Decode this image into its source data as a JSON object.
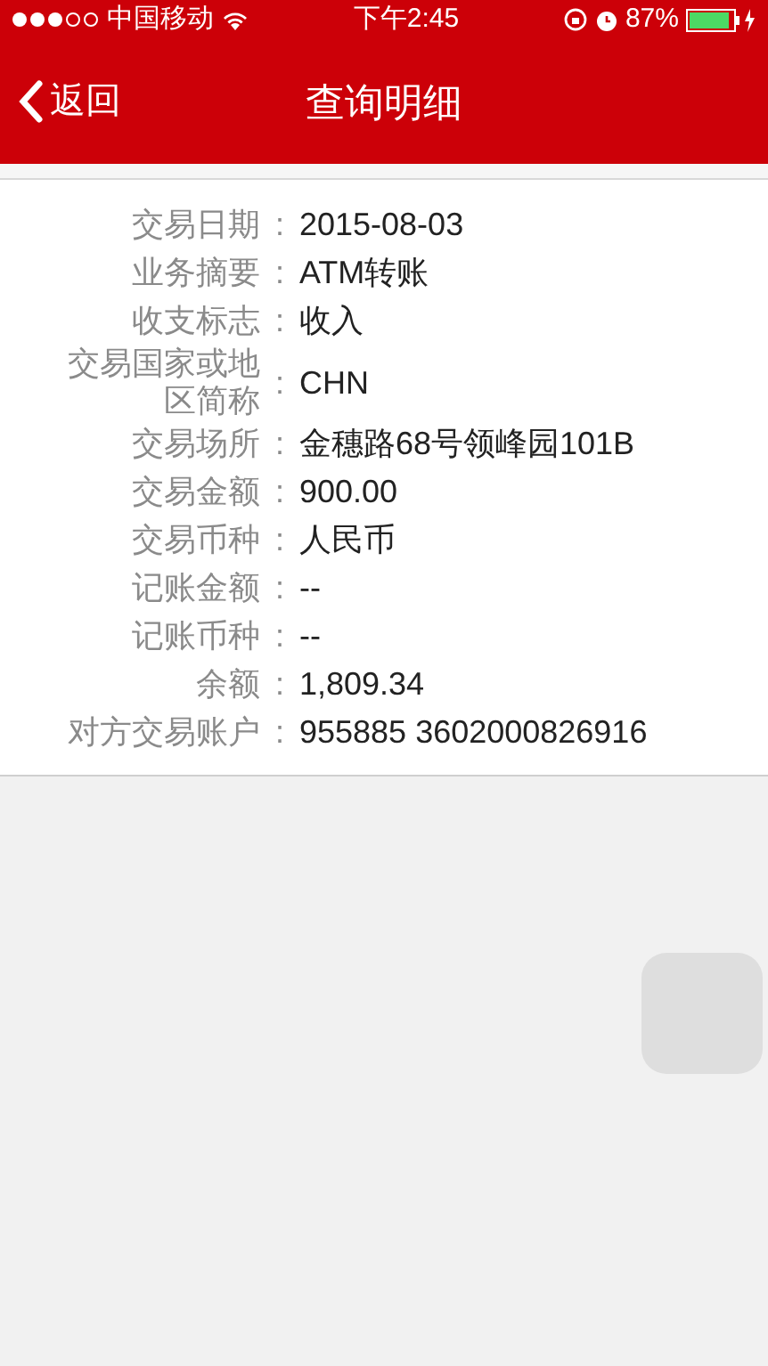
{
  "status_bar": {
    "carrier": "中国移动",
    "time": "下午2:45",
    "battery": "87%"
  },
  "nav": {
    "back": "返回",
    "title": "查询明细"
  },
  "details": [
    {
      "label": "交易日期",
      "colon": ":",
      "value": "2015-08-03"
    },
    {
      "label": "业务摘要",
      "colon": ":",
      "value": "ATM转账"
    },
    {
      "label": "收支标志",
      "colon": ":",
      "value": "收入"
    },
    {
      "label": "交易国家或地区简称",
      "colon": ":",
      "value": "CHN"
    },
    {
      "label": "交易场所",
      "colon": ":",
      "value": "金穗路68号领峰园101B"
    },
    {
      "label": "交易金额",
      "colon": ":",
      "value": "900.00"
    },
    {
      "label": "交易币种",
      "colon": ":",
      "value": "人民币"
    },
    {
      "label": "记账金额",
      "colon": ":",
      "value": "--"
    },
    {
      "label": "记账币种",
      "colon": ":",
      "value": "--"
    },
    {
      "label": "余额",
      "colon": ":",
      "value": "1,809.34"
    },
    {
      "label": "对方交易账户",
      "colon": ":",
      "value": "955885 3602000826916"
    }
  ]
}
